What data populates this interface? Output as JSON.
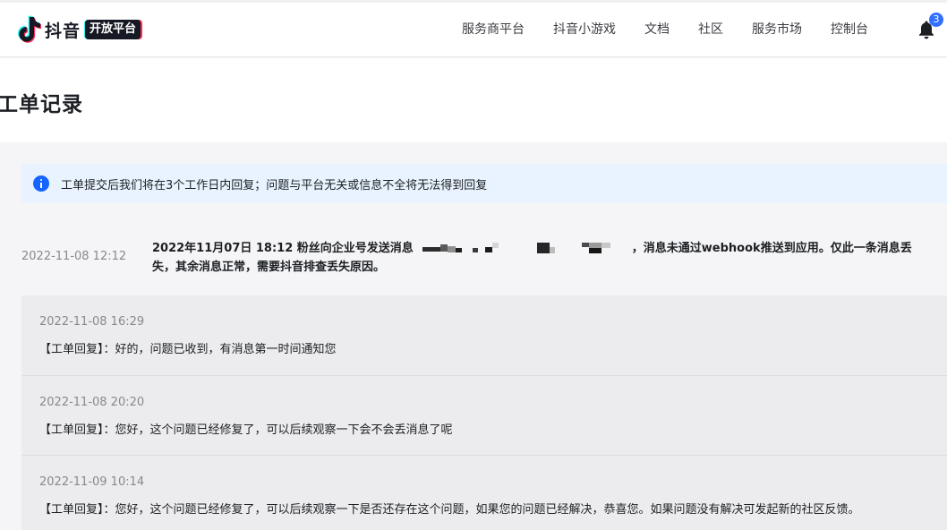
{
  "header": {
    "brand": "抖音",
    "brand_tag": "开放平台",
    "nav": [
      "服务商平台",
      "抖音小游戏",
      "文档",
      "社区",
      "服务市场",
      "控制台"
    ],
    "notification_count": "3"
  },
  "page": {
    "title": "工单记录"
  },
  "alert": {
    "text": "工单提交后我们将在3个工作日内回复；问题与平台无关或信息不全将无法得到回复"
  },
  "ticket": {
    "date": "2022-11-08 12:12",
    "content_before": "2022年11月07日 18:12 粉丝向企业号发送消息",
    "content_after": "，消息未通过webhook推送到应用。仅此一条消息丢失，其余消息正常，需要抖音排查丢失原因。"
  },
  "replies": [
    {
      "time": "2022-11-08 16:29",
      "label": "【工单回复】：",
      "text": "好的，问题已收到，有消息第一时间通知您"
    },
    {
      "time": "2022-11-08 20:20",
      "label": "【工单回复】：",
      "text": "您好，这个问题已经修复了，可以后续观察一下会不会丢消息了呢"
    },
    {
      "time": "2022-11-09 10:14",
      "label": "【工单回复】：",
      "text": "您好，这个问题已经修复了，可以后续观察一下是否还存在这个问题，如果您的问题已经解决，恭喜您。如果问题没有解决可发起新的社区反馈。"
    }
  ]
}
